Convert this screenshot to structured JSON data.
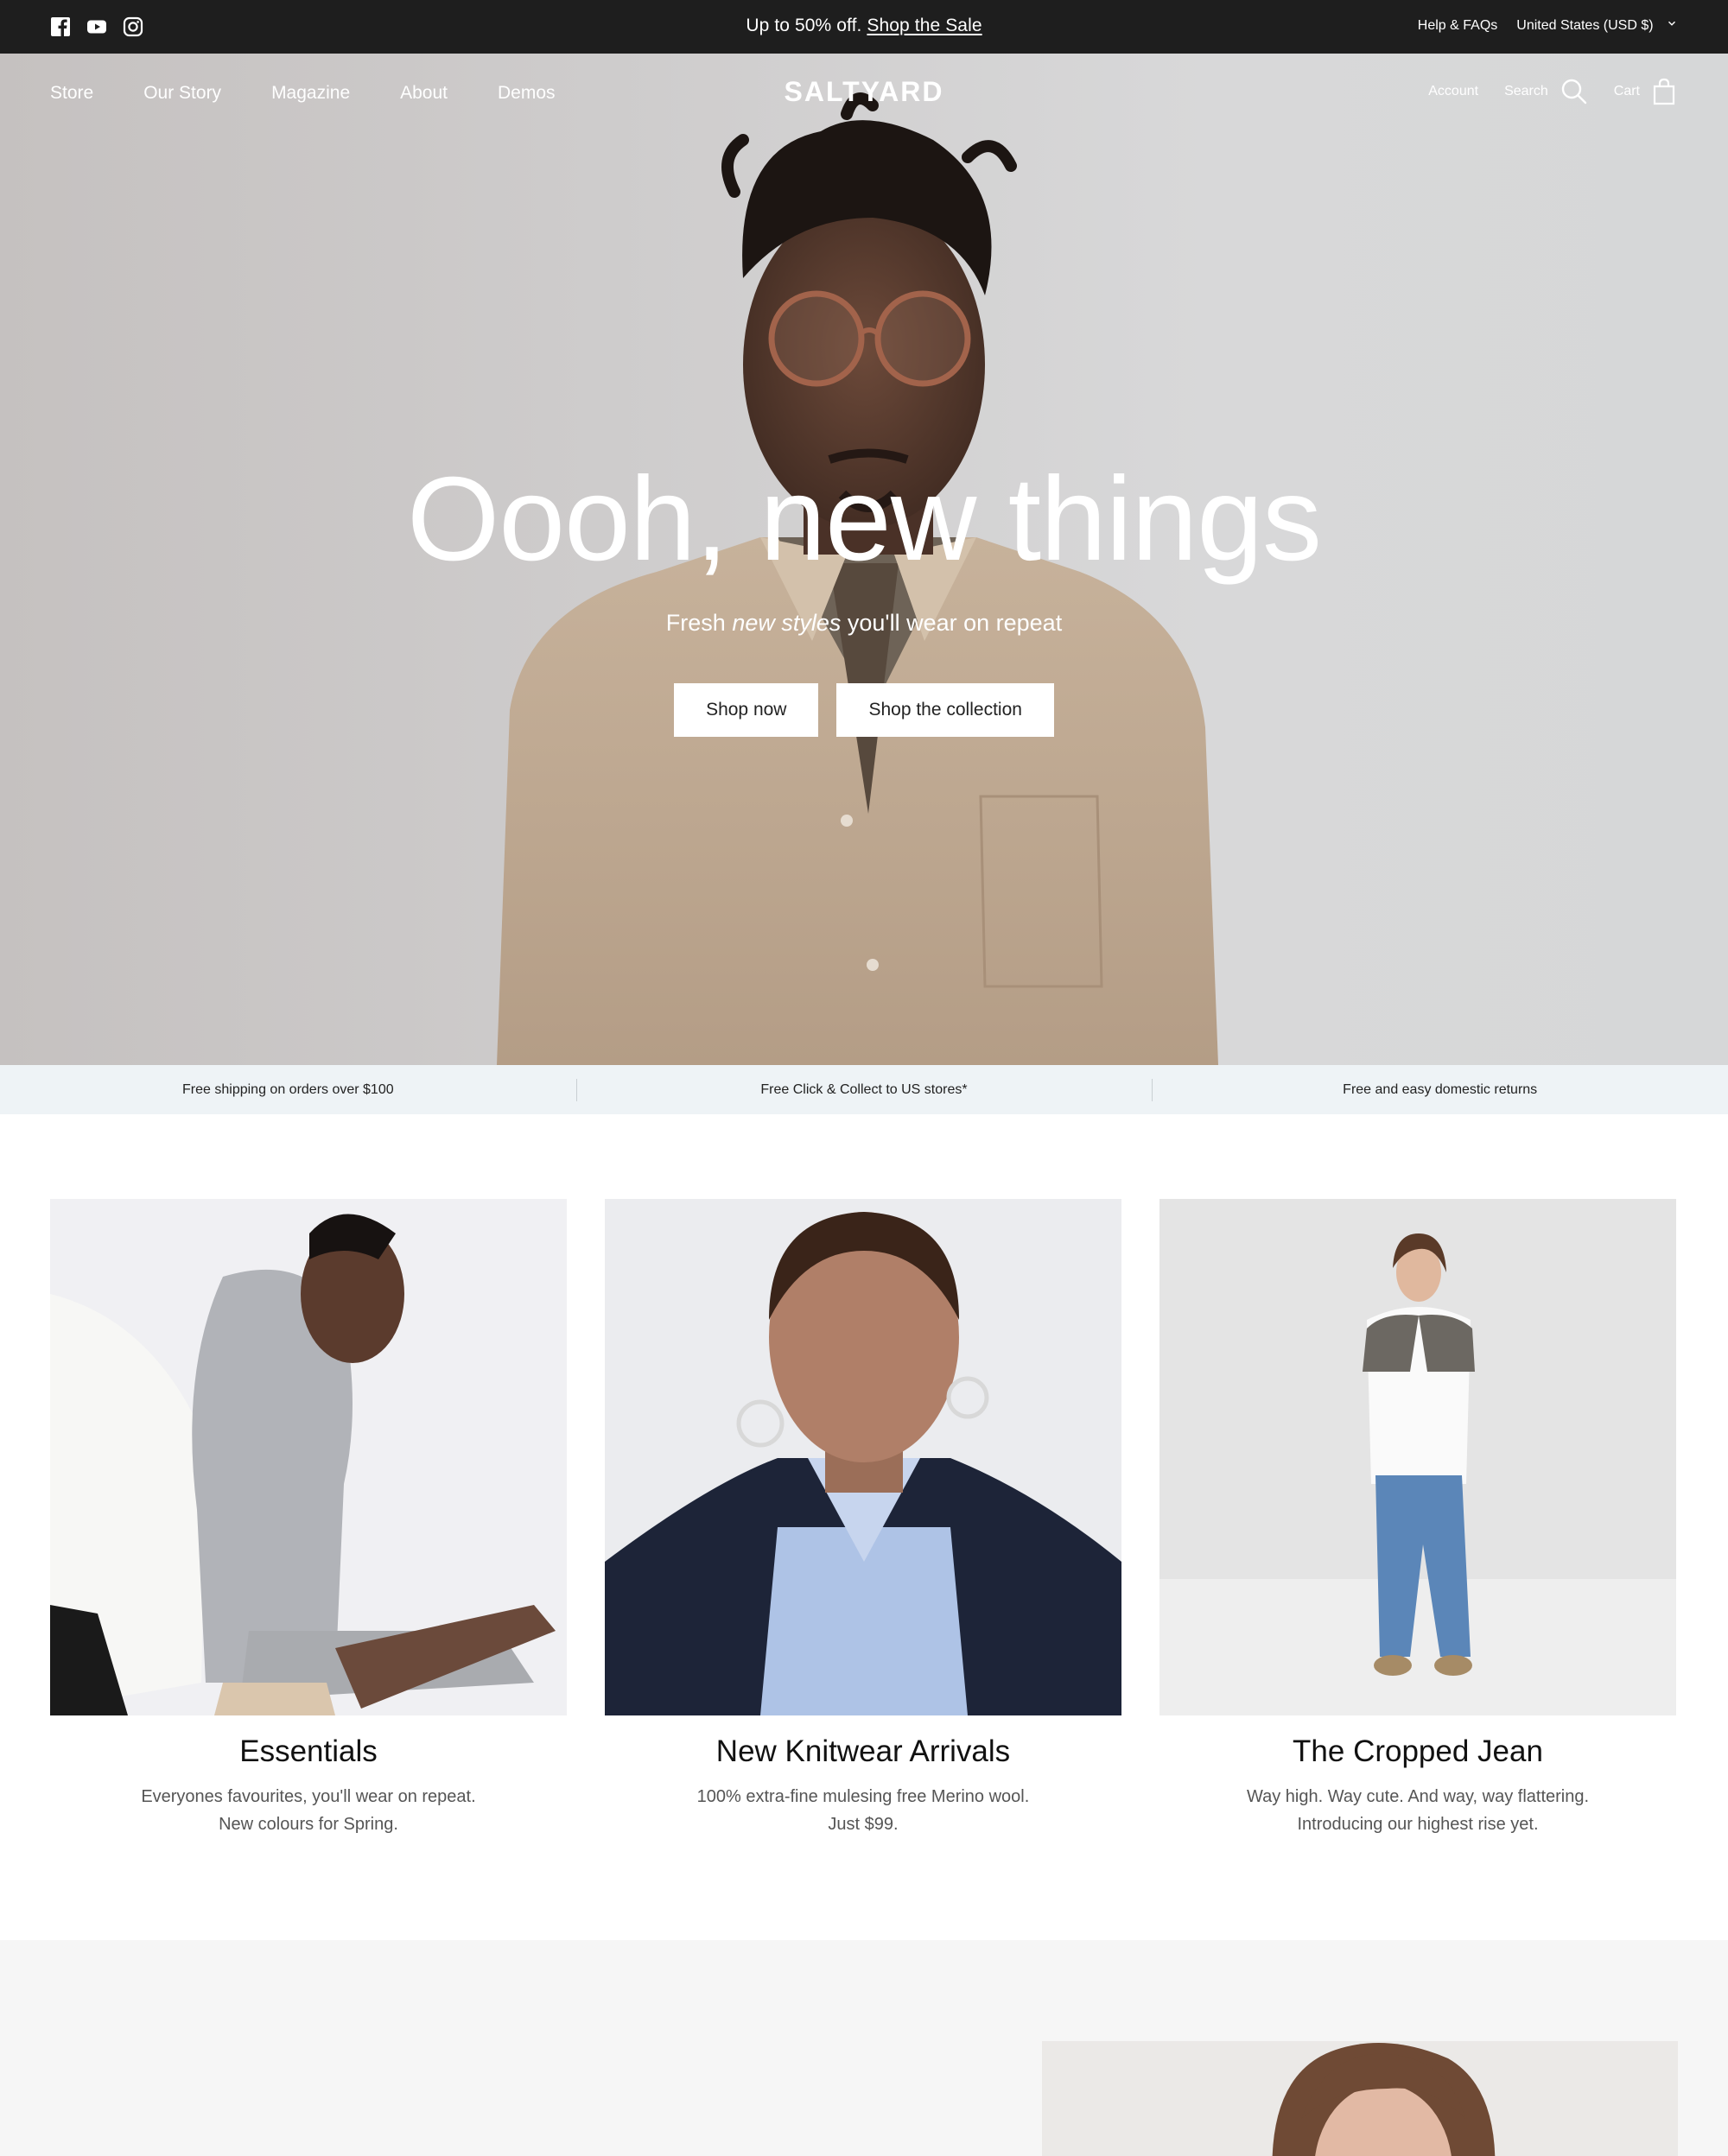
{
  "topbar": {
    "social": [
      "facebook-icon",
      "youtube-icon",
      "instagram-icon"
    ],
    "promo_text": "Up to 50% off.",
    "promo_link": "Shop the Sale",
    "help": "Help & FAQs",
    "region": "United States (USD $)"
  },
  "header": {
    "nav": [
      "Store",
      "Our Story",
      "Magazine",
      "About",
      "Demos"
    ],
    "logo": "SALTYARD",
    "account": "Account",
    "search": "Search",
    "cart": "Cart"
  },
  "hero": {
    "title": "Oooh, new things",
    "subtitle_pre": "Fresh ",
    "subtitle_em": "new styles",
    "subtitle_post": " you'll wear on repeat",
    "btn_primary": "Shop now",
    "btn_secondary": "Shop the collection"
  },
  "features": [
    "Free shipping on orders over $100",
    "Free Click & Collect to US stores*",
    "Free and easy domestic returns"
  ],
  "collections": [
    {
      "title": "Essentials",
      "line1": "Everyones favourites, you'll wear on repeat.",
      "line2": "New colours for Spring."
    },
    {
      "title": "New Knitwear Arrivals",
      "line1": "100% extra-fine mulesing free Merino wool.",
      "line2": "Just $99."
    },
    {
      "title": "The Cropped Jean",
      "line1": "Way high. Way cute. And way, way flattering.",
      "line2": "Introducing our highest rise yet."
    }
  ],
  "colors": {
    "topbar_bg": "#1e1e1e",
    "features_bg": "#eef3f6",
    "lower_bg": "#f6f6f6"
  }
}
